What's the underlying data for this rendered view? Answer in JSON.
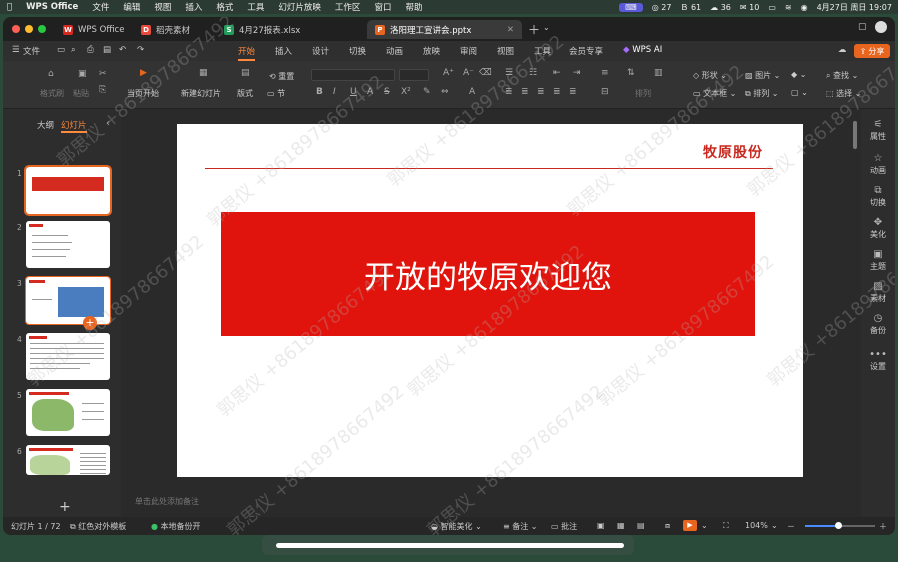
{
  "menubar": {
    "app_name": "WPS Office",
    "items": [
      "文件",
      "编辑",
      "视图",
      "插入",
      "格式",
      "工具",
      "幻灯片放映",
      "工作区",
      "窗口",
      "帮助"
    ],
    "status": {
      "item1": "27",
      "item2": "61",
      "item3": "36",
      "item4": "10",
      "datetime": "4月27日 周日  19:07"
    }
  },
  "tabs": [
    {
      "label": "WPS Office",
      "icon": "wps-icon"
    },
    {
      "label": "稻壳素材",
      "icon": "docer-icon"
    },
    {
      "label": "4月27报表.xlsx",
      "icon": "spreadsheet-icon"
    },
    {
      "label": "洛阳理工宣讲会.pptx",
      "icon": "presentation-icon"
    }
  ],
  "ribbon": {
    "file_label": "文件",
    "tabs": [
      "开始",
      "插入",
      "设计",
      "切换",
      "动画",
      "放映",
      "审阅",
      "视图",
      "工具",
      "会员专享"
    ],
    "ai_label": "WPS AI",
    "share_label": "分享"
  },
  "toolbar": {
    "format_painter": "格式刷",
    "paste": "粘贴",
    "from_current": "当页开始",
    "new_slide": "新建幻灯片",
    "reset": "重置",
    "layout": "版式",
    "section": "节",
    "shape": "形状",
    "picture": "图片",
    "find": "查找",
    "textbox": "文本框",
    "arrange": "排列",
    "select": "选择",
    "text_ops": "排列"
  },
  "leftpanel": {
    "tab_outline": "大纲",
    "tab_slides": "幻灯片",
    "slide_numbers": [
      "1",
      "2",
      "3",
      "4",
      "5",
      "6"
    ]
  },
  "slide": {
    "brand": "牧原股份",
    "title": "开放的牧原欢迎您"
  },
  "notes_placeholder": "单击此处添加备注",
  "rightbar": [
    "属性",
    "动画",
    "切换",
    "美化",
    "主题",
    "素材",
    "备份",
    "设置"
  ],
  "statusbar": {
    "slide_count": "幻灯片 1 / 72",
    "template": "红色对外模板",
    "backup": "本地备份开",
    "beautify": "智能美化",
    "notes": "备注",
    "comments": "批注",
    "zoom": "104%"
  },
  "watermark": "郭思仪 +8618978667492"
}
